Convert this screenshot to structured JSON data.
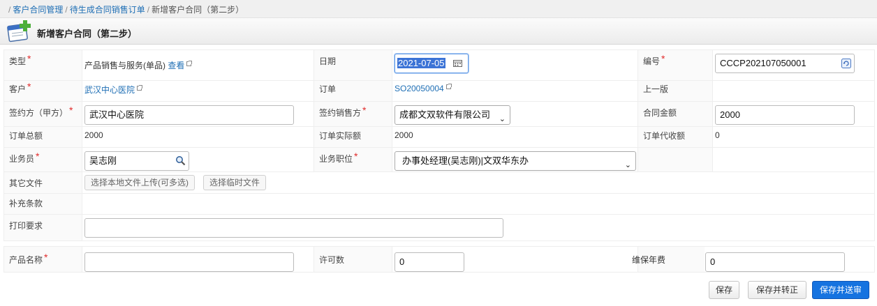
{
  "breadcrumb": {
    "lead": "/",
    "item1": "客户合同管理",
    "sep1": "/",
    "item2": "待生成合同销售订单",
    "sep2": "/",
    "current": "新增客户合同（第二步）"
  },
  "header": {
    "title": "新增客户合同（第二步）",
    "icon": "new-contract-icon"
  },
  "required_mark": "*",
  "fields": {
    "type": {
      "label": "类型",
      "value": "产品销售与服务(单品)",
      "link": "查看"
    },
    "date": {
      "label": "日期",
      "value": "2021-07-05"
    },
    "number": {
      "label": "编号",
      "value": "CCCP202107050001"
    },
    "customer": {
      "label": "客户",
      "value": "武汉中心医院"
    },
    "order": {
      "label": "订单",
      "value": "SO20050004"
    },
    "previous": {
      "label": "上一版"
    },
    "party_a": {
      "label": "签约方（甲方）",
      "value": "武汉中心医院"
    },
    "sales_party": {
      "label": "签约销售方",
      "value": "成都文双软件有限公司"
    },
    "contract_amount": {
      "label": "合同金额",
      "value": "2000"
    },
    "order_total": {
      "label": "订单总额",
      "value": "2000"
    },
    "order_actual": {
      "label": "订单实际额",
      "value": "2000"
    },
    "order_collect": {
      "label": "订单代收额",
      "value": "0"
    },
    "salesman": {
      "label": "业务员",
      "value": "吴志刚"
    },
    "position": {
      "label": "业务职位",
      "value": "办事处经理(吴志刚)|文双华东办"
    },
    "files": {
      "label": "其它文件",
      "upload": "选择本地文件上传(可多选)",
      "temp": "选择临时文件"
    },
    "supplement": {
      "label": "补充条款"
    },
    "print": {
      "label": "打印要求",
      "value": ""
    },
    "product_name": {
      "label": "产品名称",
      "value": ""
    },
    "license_count": {
      "label": "许可数",
      "value": "0"
    },
    "maintenance_fee": {
      "label": "维保年费",
      "value": "0"
    }
  },
  "buttons": {
    "save": "保存",
    "save_convert": "保存并转正",
    "save_submit": "保存并送审"
  }
}
